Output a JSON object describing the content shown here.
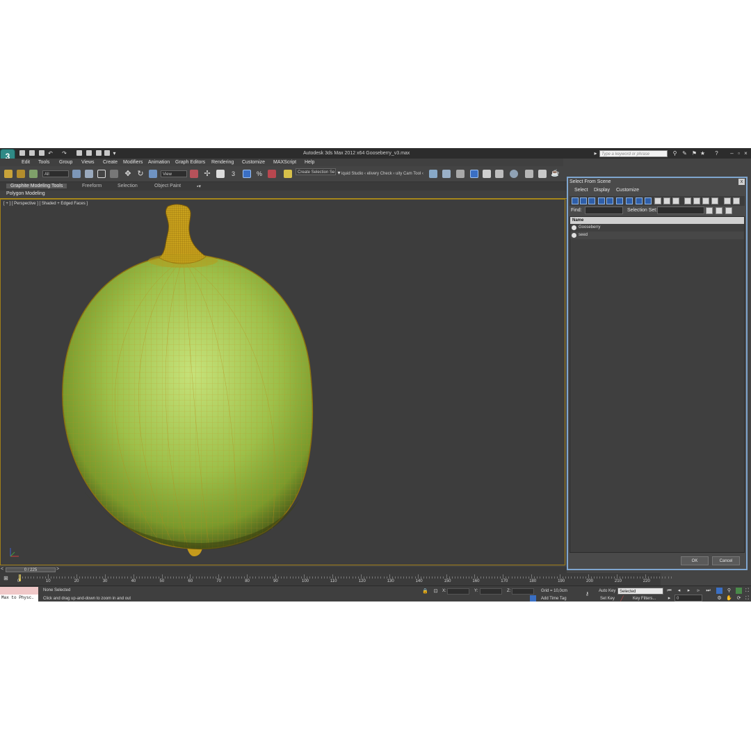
{
  "titlebar": {
    "app_title": "Autodesk 3ds Max  2012 x64     Gooseberry_v3.max",
    "search_placeholder": "Type a keyword or phrase",
    "logo_text": "3"
  },
  "menu": [
    "Edit",
    "Tools",
    "Group",
    "Views",
    "Create",
    "Modifiers",
    "Animation",
    "Graph Editors",
    "Rendering",
    "Customize",
    "MAXScript",
    "Help"
  ],
  "toolbar": {
    "filter_value": "All",
    "ref_coord_value": "View",
    "snap_label": "3",
    "selection_set_value": "Create Selection Se",
    "plugin_text": "iquid Studio ‹ elivery Check  ‹ uity Cam Tool ‹"
  },
  "ribbon": {
    "tabs": [
      "Graphite Modeling Tools",
      "Freeform",
      "Selection",
      "Object Paint"
    ],
    "sub_label": "Polygon Modeling"
  },
  "viewport": {
    "label": "[ + ] [ Perspective ] [ Shaded + Edged Faces ]"
  },
  "dialog": {
    "title": "Select From Scene",
    "close_label": "x",
    "menu": [
      "Select",
      "Display",
      "Customize"
    ],
    "find_label": "Find:",
    "selection_set_label": "Selection Set:",
    "list_header": "Name",
    "items": [
      "Gooseberry",
      "seed"
    ],
    "ok_label": "OK",
    "cancel_label": "Cancel"
  },
  "timeline": {
    "slider_label": "0 / 225",
    "ticks": [
      "0",
      "10",
      "20",
      "30",
      "40",
      "50",
      "60",
      "70",
      "80",
      "90",
      "100",
      "110",
      "120",
      "130",
      "140",
      "150",
      "160",
      "170",
      "180",
      "190",
      "200",
      "210",
      "220"
    ]
  },
  "status": {
    "maxscript_text": "Max to Physc.",
    "selection_status": "None Selected",
    "prompt": "Click and drag up-and-down to zoom in and out",
    "x_label": "X:",
    "y_label": "Y:",
    "z_label": "Z:",
    "grid": "Grid = 10,0cm",
    "add_time_tag": "Add Time Tag",
    "auto_key": "Auto Key",
    "set_key": "Set Key",
    "key_mode_value": "Selected",
    "key_filters": "Key Filters...",
    "frame_value": "0"
  },
  "colors": {
    "viewport_bg": "#3d3d3d",
    "ui_bg": "#444444",
    "dialog_border": "#7fa6cf",
    "viewport_border": "#a07f18",
    "fruit_green": "#9dc04a",
    "wire_orange": "#c79420"
  }
}
